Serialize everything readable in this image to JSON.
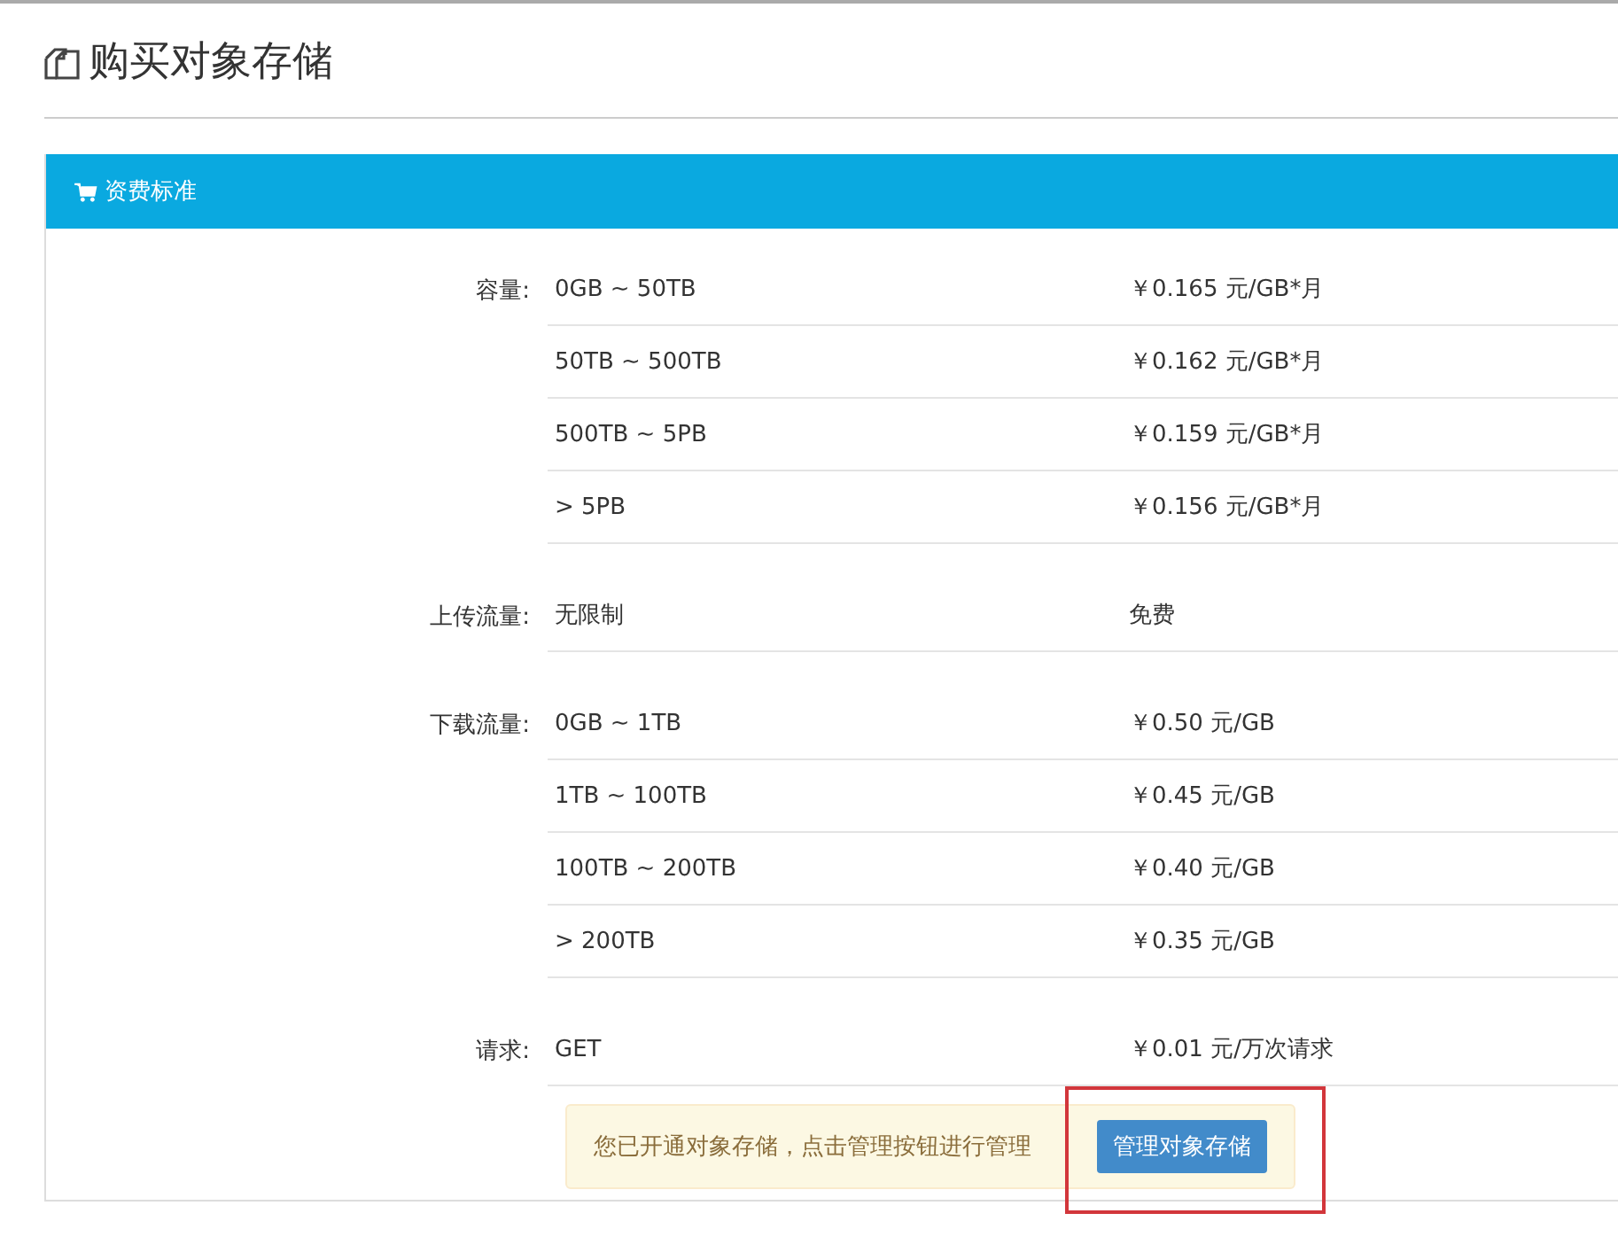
{
  "page_title": "购买对象存储",
  "panel": {
    "title": "资费标准",
    "groups": [
      {
        "label": "容量:",
        "rows": [
          {
            "range": "0GB ~ 50TB",
            "price": "￥0.165 元/GB*月"
          },
          {
            "range": "50TB ~ 500TB",
            "price": "￥0.162 元/GB*月"
          },
          {
            "range": "500TB ~ 5PB",
            "price": "￥0.159 元/GB*月"
          },
          {
            "range": "> 5PB",
            "price": "￥0.156 元/GB*月"
          }
        ]
      },
      {
        "label": "上传流量:",
        "rows": [
          {
            "range": "无限制",
            "price": "免费"
          }
        ]
      },
      {
        "label": "下载流量:",
        "rows": [
          {
            "range": "0GB ~ 1TB",
            "price": "￥0.50 元/GB"
          },
          {
            "range": "1TB ~ 100TB",
            "price": "￥0.45 元/GB"
          },
          {
            "range": "100TB ~ 200TB",
            "price": "￥0.40 元/GB"
          },
          {
            "range": "> 200TB",
            "price": "￥0.35 元/GB"
          }
        ]
      },
      {
        "label": "请求:",
        "rows": [
          {
            "range": "GET",
            "price": "￥0.01 元/万次请求"
          }
        ]
      }
    ],
    "notice": {
      "text": "您已开通对象存储，点击管理按钮进行管理",
      "button": "管理对象存储"
    }
  }
}
